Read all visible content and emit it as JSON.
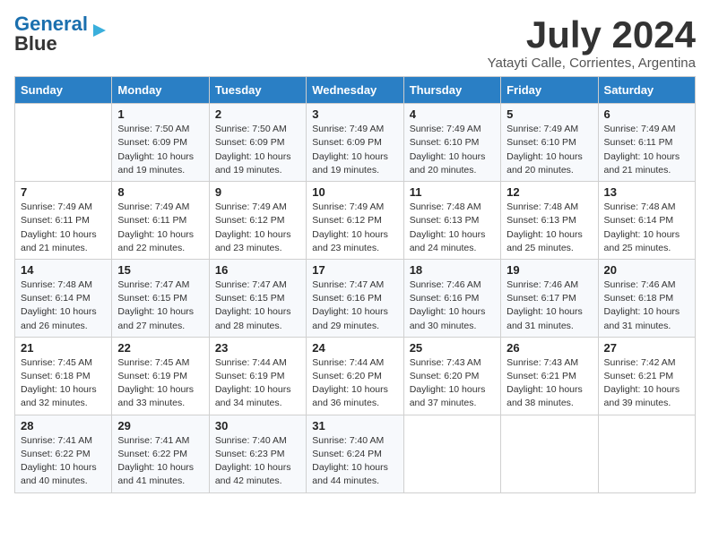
{
  "logo": {
    "part1": "General",
    "part2": "Blue"
  },
  "header": {
    "month_year": "July 2024",
    "location": "Yatayti Calle, Corrientes, Argentina"
  },
  "weekdays": [
    "Sunday",
    "Monday",
    "Tuesday",
    "Wednesday",
    "Thursday",
    "Friday",
    "Saturday"
  ],
  "weeks": [
    [
      {
        "day": "",
        "sunrise": "",
        "sunset": "",
        "daylight": ""
      },
      {
        "day": "1",
        "sunrise": "7:50 AM",
        "sunset": "6:09 PM",
        "daylight": "10 hours and 19 minutes."
      },
      {
        "day": "2",
        "sunrise": "7:50 AM",
        "sunset": "6:09 PM",
        "daylight": "10 hours and 19 minutes."
      },
      {
        "day": "3",
        "sunrise": "7:49 AM",
        "sunset": "6:09 PM",
        "daylight": "10 hours and 19 minutes."
      },
      {
        "day": "4",
        "sunrise": "7:49 AM",
        "sunset": "6:10 PM",
        "daylight": "10 hours and 20 minutes."
      },
      {
        "day": "5",
        "sunrise": "7:49 AM",
        "sunset": "6:10 PM",
        "daylight": "10 hours and 20 minutes."
      },
      {
        "day": "6",
        "sunrise": "7:49 AM",
        "sunset": "6:11 PM",
        "daylight": "10 hours and 21 minutes."
      }
    ],
    [
      {
        "day": "7",
        "sunrise": "7:49 AM",
        "sunset": "6:11 PM",
        "daylight": "10 hours and 21 minutes."
      },
      {
        "day": "8",
        "sunrise": "7:49 AM",
        "sunset": "6:11 PM",
        "daylight": "10 hours and 22 minutes."
      },
      {
        "day": "9",
        "sunrise": "7:49 AM",
        "sunset": "6:12 PM",
        "daylight": "10 hours and 23 minutes."
      },
      {
        "day": "10",
        "sunrise": "7:49 AM",
        "sunset": "6:12 PM",
        "daylight": "10 hours and 23 minutes."
      },
      {
        "day": "11",
        "sunrise": "7:48 AM",
        "sunset": "6:13 PM",
        "daylight": "10 hours and 24 minutes."
      },
      {
        "day": "12",
        "sunrise": "7:48 AM",
        "sunset": "6:13 PM",
        "daylight": "10 hours and 25 minutes."
      },
      {
        "day": "13",
        "sunrise": "7:48 AM",
        "sunset": "6:14 PM",
        "daylight": "10 hours and 25 minutes."
      }
    ],
    [
      {
        "day": "14",
        "sunrise": "7:48 AM",
        "sunset": "6:14 PM",
        "daylight": "10 hours and 26 minutes."
      },
      {
        "day": "15",
        "sunrise": "7:47 AM",
        "sunset": "6:15 PM",
        "daylight": "10 hours and 27 minutes."
      },
      {
        "day": "16",
        "sunrise": "7:47 AM",
        "sunset": "6:15 PM",
        "daylight": "10 hours and 28 minutes."
      },
      {
        "day": "17",
        "sunrise": "7:47 AM",
        "sunset": "6:16 PM",
        "daylight": "10 hours and 29 minutes."
      },
      {
        "day": "18",
        "sunrise": "7:46 AM",
        "sunset": "6:16 PM",
        "daylight": "10 hours and 30 minutes."
      },
      {
        "day": "19",
        "sunrise": "7:46 AM",
        "sunset": "6:17 PM",
        "daylight": "10 hours and 31 minutes."
      },
      {
        "day": "20",
        "sunrise": "7:46 AM",
        "sunset": "6:18 PM",
        "daylight": "10 hours and 31 minutes."
      }
    ],
    [
      {
        "day": "21",
        "sunrise": "7:45 AM",
        "sunset": "6:18 PM",
        "daylight": "10 hours and 32 minutes."
      },
      {
        "day": "22",
        "sunrise": "7:45 AM",
        "sunset": "6:19 PM",
        "daylight": "10 hours and 33 minutes."
      },
      {
        "day": "23",
        "sunrise": "7:44 AM",
        "sunset": "6:19 PM",
        "daylight": "10 hours and 34 minutes."
      },
      {
        "day": "24",
        "sunrise": "7:44 AM",
        "sunset": "6:20 PM",
        "daylight": "10 hours and 36 minutes."
      },
      {
        "day": "25",
        "sunrise": "7:43 AM",
        "sunset": "6:20 PM",
        "daylight": "10 hours and 37 minutes."
      },
      {
        "day": "26",
        "sunrise": "7:43 AM",
        "sunset": "6:21 PM",
        "daylight": "10 hours and 38 minutes."
      },
      {
        "day": "27",
        "sunrise": "7:42 AM",
        "sunset": "6:21 PM",
        "daylight": "10 hours and 39 minutes."
      }
    ],
    [
      {
        "day": "28",
        "sunrise": "7:41 AM",
        "sunset": "6:22 PM",
        "daylight": "10 hours and 40 minutes."
      },
      {
        "day": "29",
        "sunrise": "7:41 AM",
        "sunset": "6:22 PM",
        "daylight": "10 hours and 41 minutes."
      },
      {
        "day": "30",
        "sunrise": "7:40 AM",
        "sunset": "6:23 PM",
        "daylight": "10 hours and 42 minutes."
      },
      {
        "day": "31",
        "sunrise": "7:40 AM",
        "sunset": "6:24 PM",
        "daylight": "10 hours and 44 minutes."
      },
      {
        "day": "",
        "sunrise": "",
        "sunset": "",
        "daylight": ""
      },
      {
        "day": "",
        "sunrise": "",
        "sunset": "",
        "daylight": ""
      },
      {
        "day": "",
        "sunrise": "",
        "sunset": "",
        "daylight": ""
      }
    ]
  ],
  "labels": {
    "sunrise": "Sunrise:",
    "sunset": "Sunset:",
    "daylight": "Daylight:"
  },
  "colors": {
    "header_bg": "#2a7fc5",
    "accent": "#3aafdc"
  }
}
